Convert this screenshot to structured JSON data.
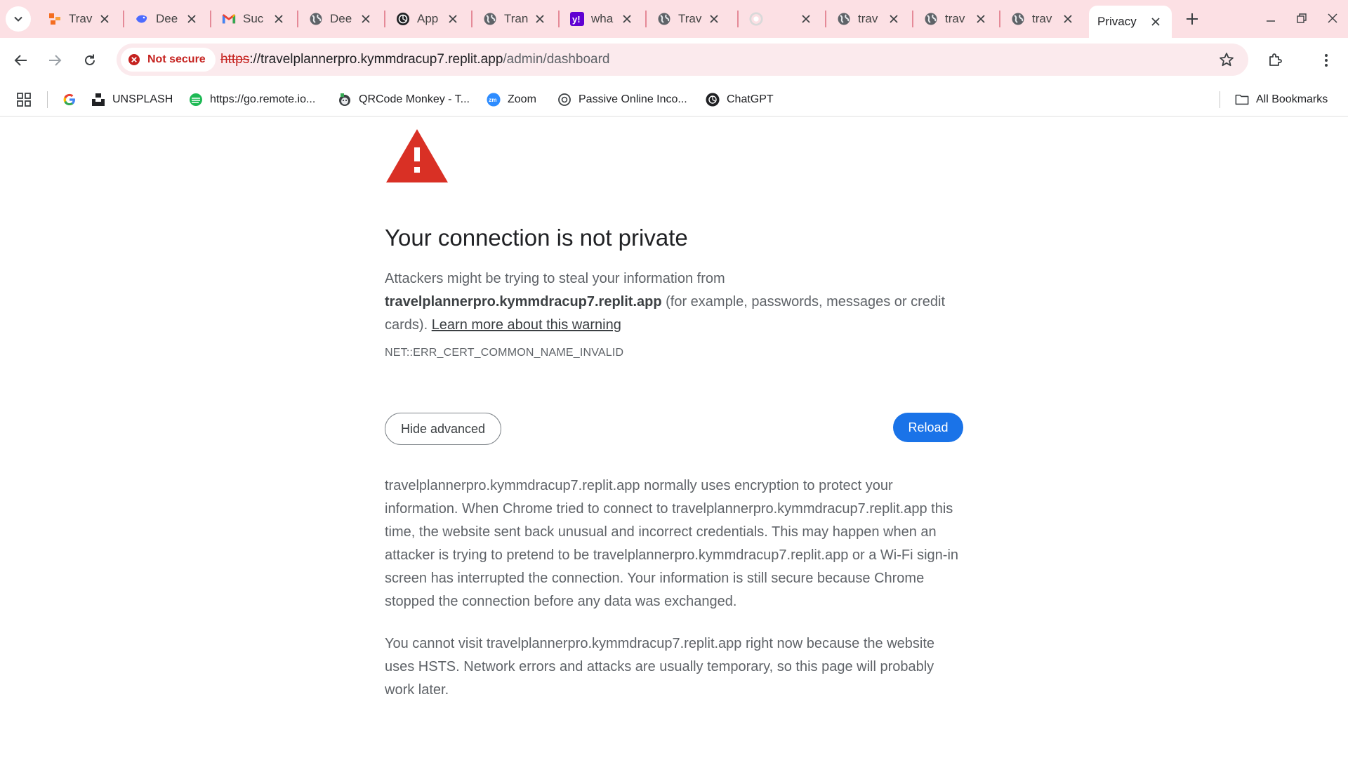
{
  "tabs": [
    {
      "title": "Trav",
      "icon": "orange-tiles-icon"
    },
    {
      "title": "Dee",
      "icon": "deepseek-whale-icon"
    },
    {
      "title": "Suc",
      "icon": "gmail-icon"
    },
    {
      "title": "Dee",
      "icon": "globe-icon"
    },
    {
      "title": "App",
      "icon": "openai-icon"
    },
    {
      "title": "Tran",
      "icon": "globe-icon"
    },
    {
      "title": "wha",
      "icon": "yahoo-icon"
    },
    {
      "title": "Trav",
      "icon": "globe-icon"
    },
    {
      "title": "",
      "icon": "loading-icon"
    },
    {
      "title": "trav",
      "icon": "globe-icon"
    },
    {
      "title": "trav",
      "icon": "globe-icon"
    },
    {
      "title": "trav",
      "icon": "globe-icon"
    }
  ],
  "active_tab": {
    "title": "Privacy"
  },
  "security_chip": {
    "label": "Not secure"
  },
  "address": {
    "scheme": "https",
    "host": "://travelplannerpro.kymmdracup7.replit.app",
    "path": "/admin/dashboard"
  },
  "bookmarks": [
    {
      "label": "",
      "icon": "google-icon"
    },
    {
      "label": "UNSPLASH",
      "icon": "unsplash-icon"
    },
    {
      "label": "https://go.remote.io...",
      "icon": "remote-io-icon"
    },
    {
      "label": "QRCode Monkey - T...",
      "icon": "qrcode-monkey-icon"
    },
    {
      "label": "Zoom",
      "icon": "zoom-icon"
    },
    {
      "label": "Passive Online Inco...",
      "icon": "openai-icon"
    },
    {
      "label": "ChatGPT",
      "icon": "openai-icon"
    }
  ],
  "all_bookmarks": "All Bookmarks",
  "interstitial": {
    "heading": "Your connection is not private",
    "msg_prefix": "Attackers might be trying to steal your information from ",
    "msg_host": "travelplannerpro.kymmdracup7.replit.app",
    "msg_suffix": " (for example, passwords, messages or credit cards). ",
    "learn_more": "Learn more about this warning",
    "error_code": "NET::ERR_CERT_COMMON_NAME_INVALID",
    "hide_advanced": "Hide advanced",
    "reload": "Reload",
    "details_1": "travelplannerpro.kymmdracup7.replit.app normally uses encryption to protect your information. When Chrome tried to connect to travelplannerpro.kymmdracup7.replit.app this time, the website sent back unusual and incorrect credentials. This may happen when an attacker is trying to pretend to be travelplannerpro.kymmdracup7.replit.app or a Wi-Fi sign-in screen has interrupted the connection. Your information is still secure because Chrome stopped the connection before any data was exchanged.",
    "details_2": "You cannot visit travelplannerpro.kymmdracup7.replit.app right now because the website uses HSTS. Network errors and attacks are usually temporary, so this page will probably work later."
  },
  "colors": {
    "accent": "#1a73e8",
    "danger": "#c5221f",
    "warning_triangle": "#d93025",
    "tabstrip": "#fce0e4"
  }
}
